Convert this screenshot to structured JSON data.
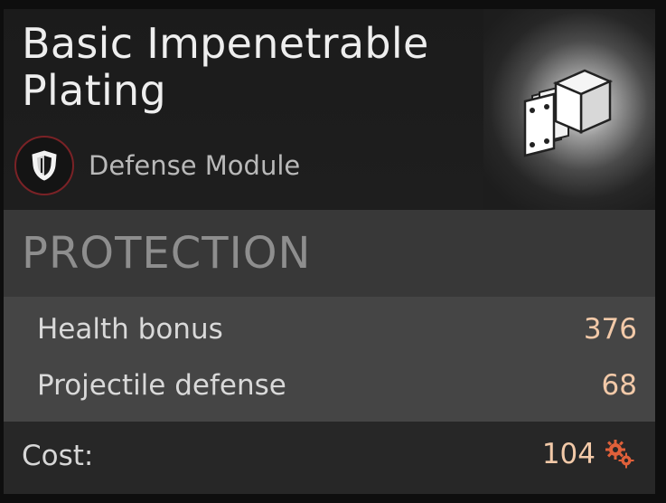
{
  "item": {
    "title": "Basic Impenetrable Plating",
    "type_label": "Defense Module",
    "type_icon": "shield-icon",
    "item_icon": "armor-plating-icon"
  },
  "section": {
    "title": "PROTECTION"
  },
  "stats": [
    {
      "label": "Health bonus",
      "value": "376"
    },
    {
      "label": "Projectile defense",
      "value": "68"
    }
  ],
  "cost": {
    "label": "Cost:",
    "value": "104",
    "currency_icon": "gears-icon"
  },
  "colors": {
    "badge_ring": "#7a2226",
    "value_text": "#f2c9a8",
    "gear_orange": "#e0603a"
  }
}
